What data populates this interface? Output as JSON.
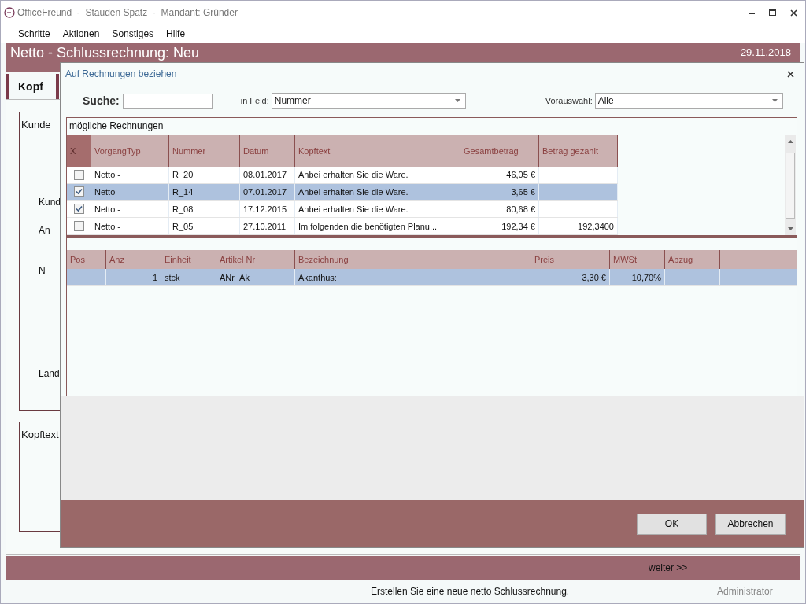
{
  "window": {
    "title": "OfficeFreund  -  Stauden Spatz  -  Mandant: Gründer"
  },
  "menu": [
    "Schritte",
    "Aktionen",
    "Sonstiges",
    "Hilfe"
  ],
  "header": {
    "title": "Netto - Schlussrechnung: Neu",
    "date": "29.11.2018"
  },
  "tabs": [
    {
      "label": "Kopf",
      "selected": true
    }
  ],
  "form": {
    "groups": [
      {
        "title": "Kunde",
        "labels": [
          "Kund",
          "An",
          "N",
          "Land"
        ]
      },
      {
        "title": "Kopftext"
      }
    ]
  },
  "dialog": {
    "title": "Auf Rechnungen beziehen",
    "search": {
      "label": "Suche:"
    },
    "field": {
      "label": "in Feld:",
      "value": "Nummer"
    },
    "preselect": {
      "label": "Vorauswahl:",
      "value": "Alle"
    },
    "invoices": {
      "caption": "mögliche Rechnungen",
      "check_column": "X",
      "columns": [
        "VorgangTyp",
        "Nummer",
        "Datum",
        "Kopftext",
        "Gesamtbetrag",
        "Betrag gezahlt"
      ],
      "rows": [
        {
          "checked": false,
          "selected": false,
          "cells": [
            "Netto -",
            "R_20",
            "08.01.2017",
            "Anbei erhalten Sie die Ware.",
            "46,05 €",
            ""
          ]
        },
        {
          "checked": true,
          "selected": true,
          "cells": [
            "Netto -",
            "R_14",
            "07.01.2017",
            "Anbei erhalten Sie die Ware.",
            "3,65 €",
            ""
          ]
        },
        {
          "checked": true,
          "selected": false,
          "cells": [
            "Netto -",
            "R_08",
            "17.12.2015",
            "Anbei erhalten Sie die Ware.",
            "80,68 €",
            ""
          ]
        },
        {
          "checked": false,
          "selected": false,
          "cells": [
            "Netto -",
            "R_05",
            "27.10.2011",
            "Im folgenden die benötigten Planu...",
            "192,34 €",
            "192,3400"
          ]
        }
      ]
    },
    "positions": {
      "columns": [
        "Pos",
        "Anz",
        "Einheit",
        "Artikel Nr",
        "Bezeichnung",
        "Preis",
        "MWSt",
        "Abzug"
      ],
      "rows": [
        {
          "selected": true,
          "cells": [
            "",
            "1",
            "stck",
            "ANr_Ak",
            "Akanthus:",
            "3,30 €",
            "10,70%",
            ""
          ]
        }
      ]
    },
    "buttons": [
      "OK",
      "Abbrechen"
    ]
  },
  "bottom_bar": {
    "next": "weiter >>"
  },
  "status_bar": {
    "message": "Erstellen Sie eine neue netto Schlussrechnung.",
    "user": "Administrator"
  }
}
